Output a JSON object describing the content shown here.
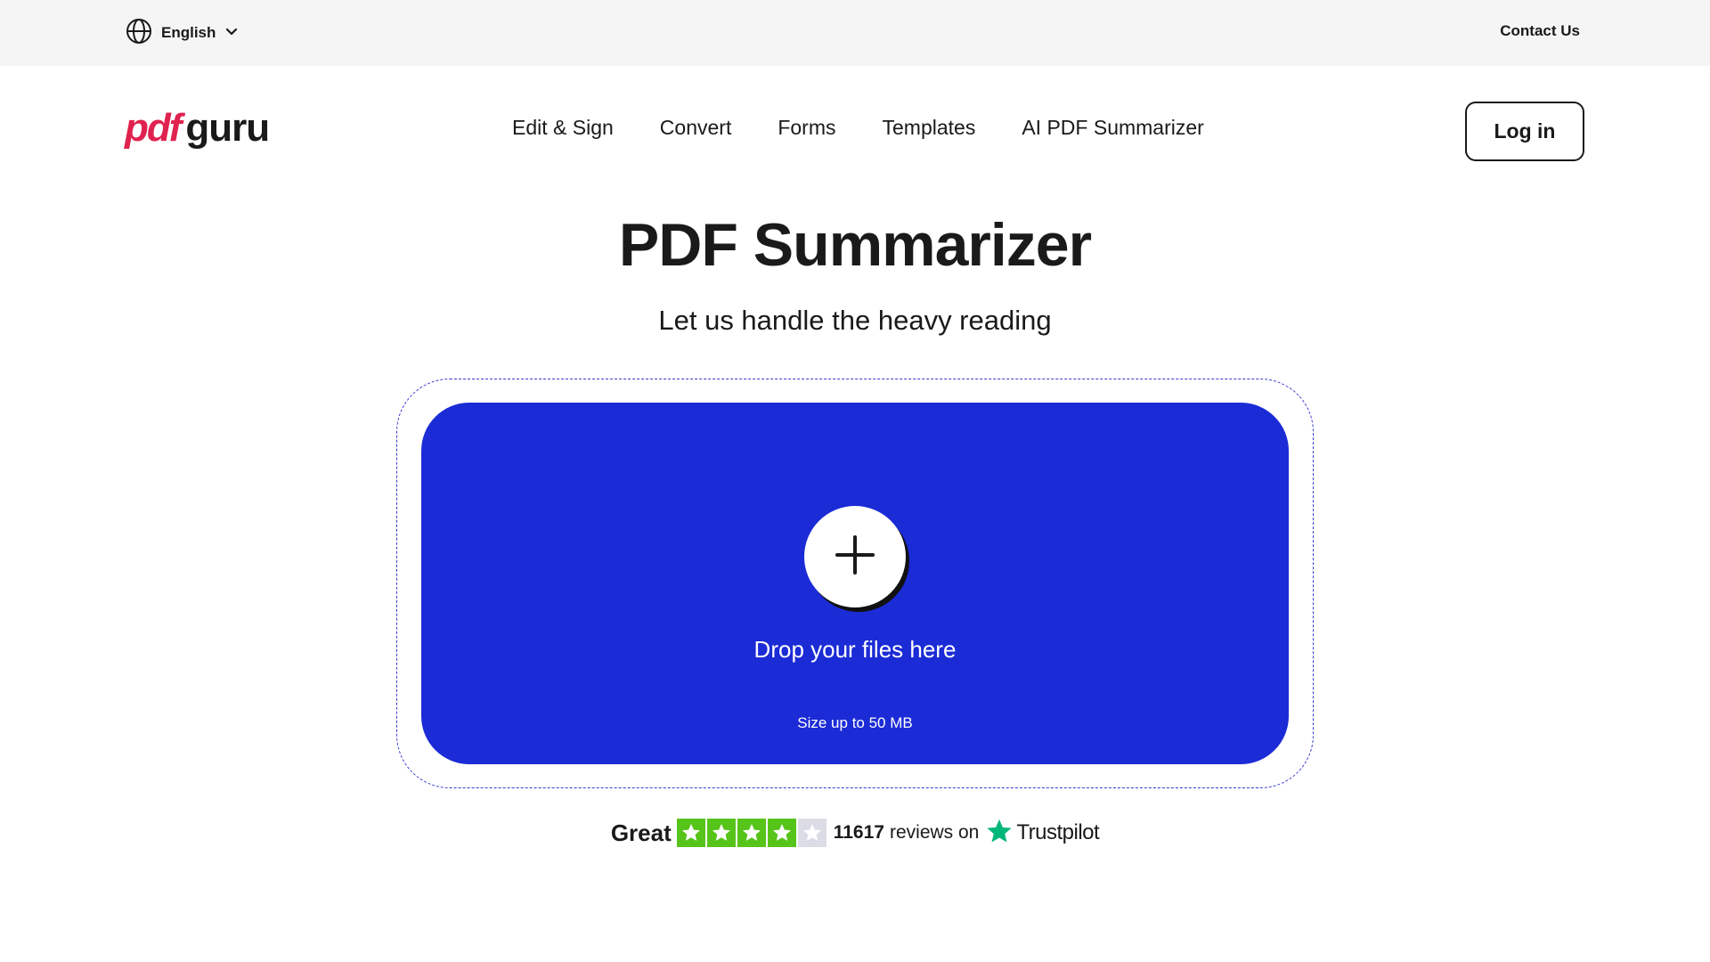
{
  "topbar": {
    "language": "English",
    "contact": "Contact Us"
  },
  "header": {
    "logo_part1": "pdf",
    "logo_part2": "guru",
    "nav": [
      "Edit & Sign",
      "Convert",
      "Forms",
      "Templates",
      "AI PDF Summarizer"
    ],
    "login": "Log in"
  },
  "hero": {
    "title": "PDF Summarizer",
    "subtitle": "Let us handle the heavy reading"
  },
  "dropzone": {
    "label": "Drop your files here",
    "size_note": "Size up to 50 MB"
  },
  "trustpilot": {
    "rating_word": "Great",
    "stars_filled": 4,
    "stars_total": 5,
    "review_count": "11617",
    "reviews_on": "reviews on",
    "brand": "Trustpilot"
  },
  "colors": {
    "brand_red": "#e0224f",
    "dropzone_blue": "#1b2bd6",
    "star_green": "#57c41a",
    "trustpilot_green": "#00b67a"
  },
  "icons": {
    "language": "globe-icon",
    "chevron": "chevron-down-icon",
    "upload": "plus-icon",
    "star": "star-icon",
    "trustpilot": "trustpilot-star-icon"
  }
}
